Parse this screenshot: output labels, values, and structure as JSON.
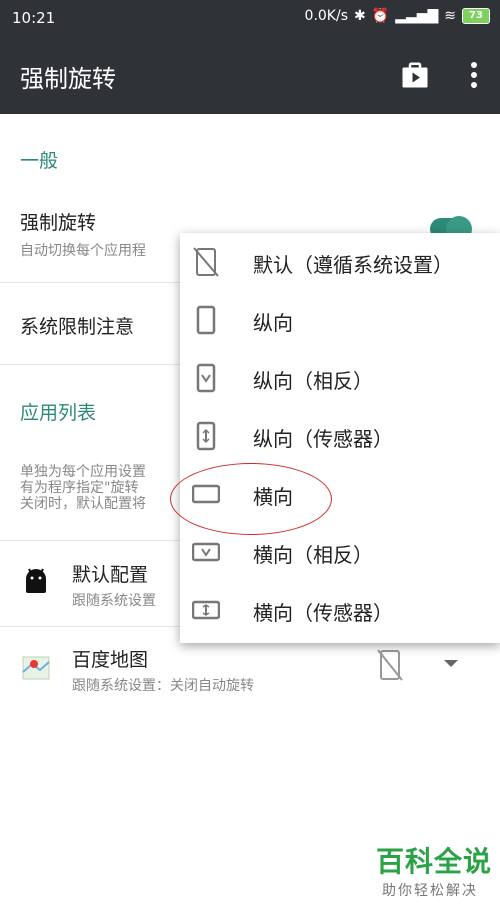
{
  "status_bar": {
    "time": "10:21",
    "speed": "0.0K/s",
    "battery": "73"
  },
  "app_bar": {
    "title": "强制旋转",
    "icons": [
      "store-icon",
      "more-vert-icon"
    ]
  },
  "settings": {
    "general_header": "一般",
    "force_rotate_title": "强制旋转",
    "force_rotate_sub": "自动切换每个应用程",
    "system_limit_title": "系统限制注意",
    "app_list_header": "应用列表",
    "info_lines": "单独为每个应用设置\n有为程序指定\"旋转\n关闭时，默认配置将"
  },
  "apps": [
    {
      "name": "默认配置",
      "sub": "跟随系统设置",
      "icon": "android-icon"
    },
    {
      "name": "百度地图",
      "sub": "跟随系统设置：关闭自动旋转",
      "icon": "baidu-map-icon"
    }
  ],
  "menu": {
    "items": [
      {
        "label": "默认（遵循系统设置）",
        "icon": "rotation-off-icon"
      },
      {
        "label": "纵向",
        "icon": "portrait-icon"
      },
      {
        "label": "纵向（相反）",
        "icon": "portrait-reverse-icon"
      },
      {
        "label": "纵向（传感器）",
        "icon": "portrait-sensor-icon"
      },
      {
        "label": "横向",
        "icon": "landscape-icon"
      },
      {
        "label": "横向（相反）",
        "icon": "landscape-reverse-icon"
      },
      {
        "label": "横向（传感器）",
        "icon": "landscape-sensor-icon"
      }
    ]
  },
  "colors": {
    "accent": "#2e8a78",
    "appbar": "#2f3236",
    "highlight_circle": "#d02a2a"
  },
  "watermark": {
    "big": "百科全说",
    "small": "助你轻松解决"
  }
}
